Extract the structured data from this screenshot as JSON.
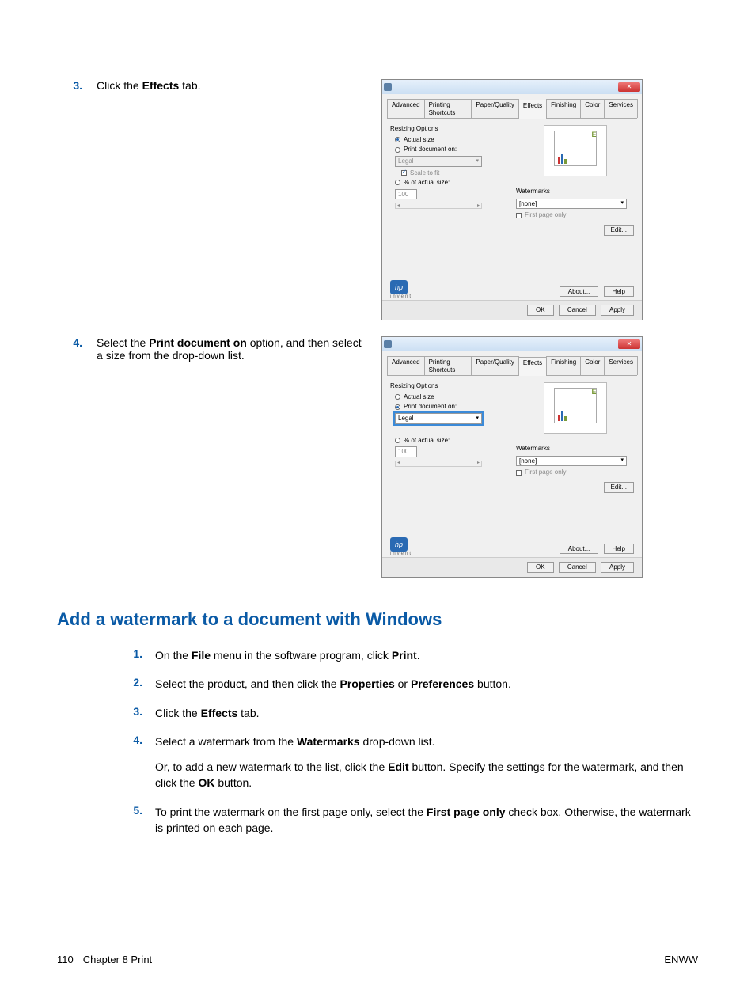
{
  "steps_top": [
    {
      "num": "3.",
      "text_parts": [
        "Click the ",
        "Effects",
        " tab."
      ]
    },
    {
      "num": "4.",
      "text_parts": [
        "Select the ",
        "Print document on",
        " option, and then select a size from the drop-down list."
      ]
    }
  ],
  "dialog": {
    "close": "✕",
    "tabs": [
      "Advanced",
      "Printing Shortcuts",
      "Paper/Quality",
      "Effects",
      "Finishing",
      "Color",
      "Services"
    ],
    "resizing_title": "Resizing Options",
    "actual_size": "Actual size",
    "print_doc_on": "Print document on:",
    "size_value": "Legal",
    "scale_to_fit": "Scale to fit",
    "pct_actual": "% of actual size:",
    "pct_value": "100",
    "watermarks_title": "Watermarks",
    "wm_value": "[none]",
    "first_page_only": "First page only",
    "edit": "Edit...",
    "logo": "hp",
    "invent": "invent",
    "about": "About...",
    "help": "Help",
    "ok": "OK",
    "cancel": "Cancel",
    "apply": "Apply",
    "pv_letter": "E"
  },
  "heading": "Add a watermark to a document with Windows",
  "sub_steps": [
    {
      "num": "1.",
      "html": "On the <b>File</b> menu in the software program, click <b>Print</b>."
    },
    {
      "num": "2.",
      "html": "Select the product, and then click the <b>Properties</b> or <b>Preferences</b> button."
    },
    {
      "num": "3.",
      "html": "Click the <b>Effects</b> tab."
    },
    {
      "num": "4.",
      "html": "Select a watermark from the <b>Watermarks</b> drop-down list.",
      "extra": "Or, to add a new watermark to the list, click the <b>Edit</b> button. Specify the settings for the watermark, and then click the <b>OK</b> button."
    },
    {
      "num": "5.",
      "html": "To print the watermark on the first page only, select the <b>First page only</b> check box. Otherwise, the watermark is printed on each page."
    }
  ],
  "footer": {
    "page": "110",
    "chapter": "Chapter 8   Print",
    "right": "ENWW"
  }
}
